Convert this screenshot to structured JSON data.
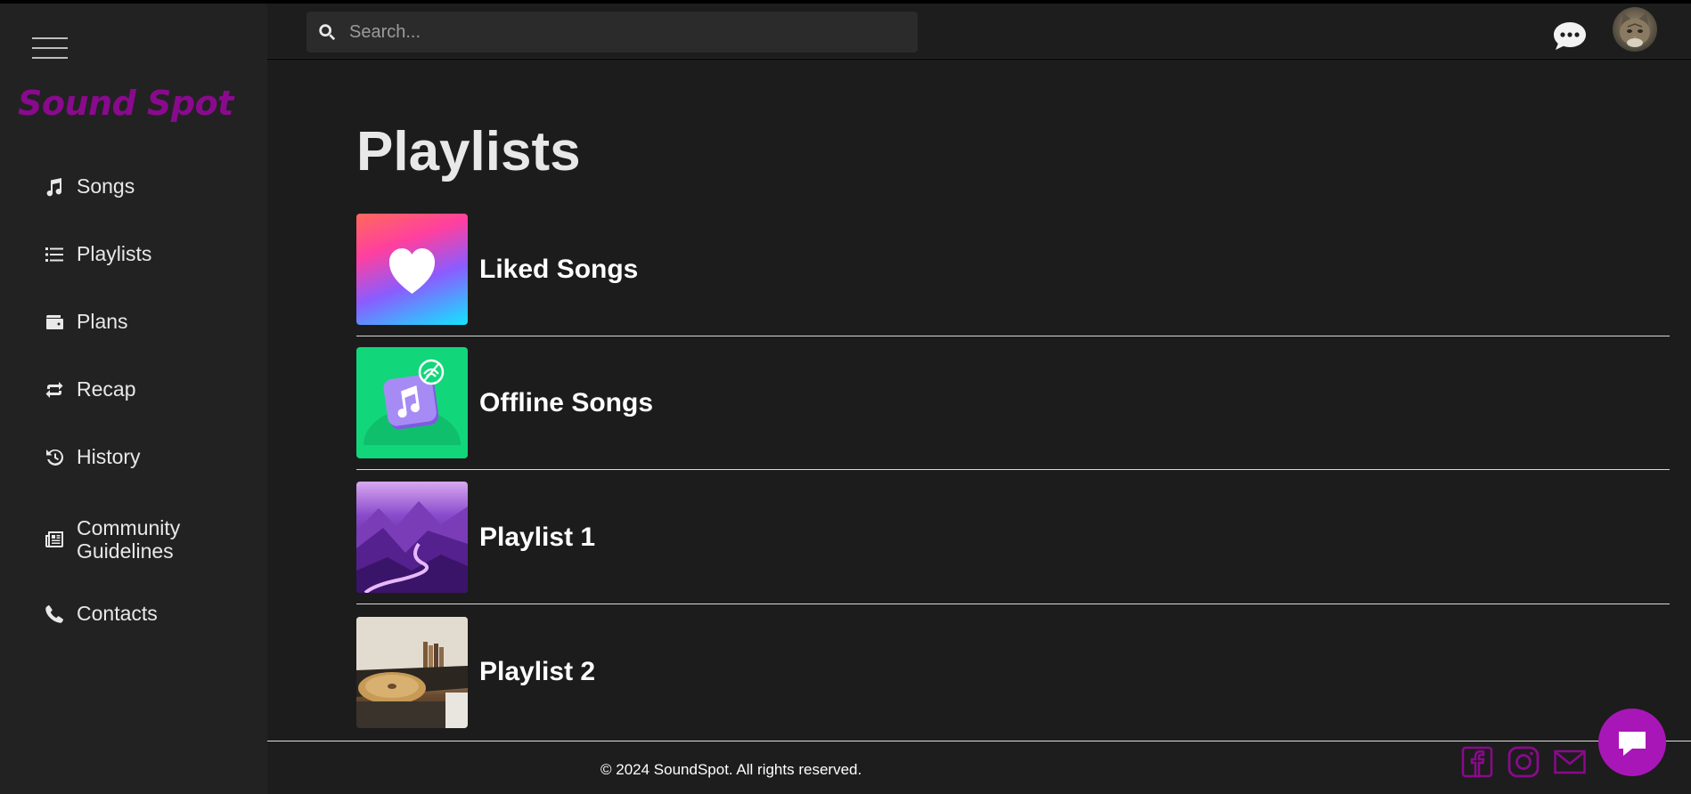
{
  "app": {
    "logo_text": "Sound Spot",
    "brand_color": "#8a0a8e",
    "accent_color": "#a916b8"
  },
  "search": {
    "placeholder": "Search..."
  },
  "sidebar": {
    "items": [
      {
        "label": "Songs",
        "icon": "music-note-icon"
      },
      {
        "label": "Playlists",
        "icon": "list-icon"
      },
      {
        "label": "Plans",
        "icon": "wallet-icon"
      },
      {
        "label": "Recap",
        "icon": "repeat-icon"
      },
      {
        "label": "History",
        "icon": "history-icon"
      },
      {
        "label_line1": "Community",
        "label_line2": "Guidelines",
        "icon": "newspaper-icon"
      },
      {
        "label": "Contacts",
        "icon": "phone-icon"
      }
    ]
  },
  "main": {
    "title": "Playlists",
    "playlists": [
      {
        "name": "Liked Songs",
        "thumb": "heart-gradient"
      },
      {
        "name": "Offline Songs",
        "thumb": "offline-music"
      },
      {
        "name": "Playlist 1",
        "thumb": "purple-valley"
      },
      {
        "name": "Playlist 2",
        "thumb": "record-player"
      }
    ]
  },
  "footer": {
    "copyright": "© 2024 SoundSpot. All rights reserved."
  }
}
